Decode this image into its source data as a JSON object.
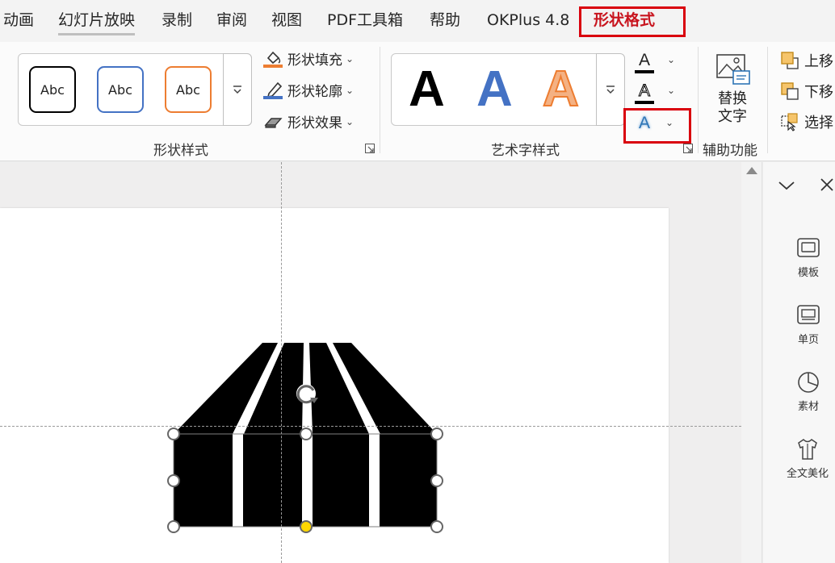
{
  "tabs": [
    {
      "label": "动画"
    },
    {
      "label": "幻灯片放映"
    },
    {
      "label": "录制"
    },
    {
      "label": "审阅"
    },
    {
      "label": "视图"
    },
    {
      "label": "PDF工具箱"
    },
    {
      "label": "帮助"
    },
    {
      "label": "OKPlus 4.8"
    },
    {
      "label": "形状格式",
      "active": true
    }
  ],
  "shape_styles": {
    "presets": [
      {
        "label": "Abc",
        "border": "#000000"
      },
      {
        "label": "Abc",
        "border": "#4472c4"
      },
      {
        "label": "Abc",
        "border": "#ed7d31"
      }
    ],
    "fill_label": "形状填充",
    "outline_label": "形状轮廓",
    "effects_label": "形状效果",
    "group_label": "形状样式"
  },
  "wordart": {
    "presets": [
      {
        "label": "A",
        "color": "#000000"
      },
      {
        "label": "A",
        "color": "#4472c4"
      },
      {
        "label": "A",
        "color": "#f4b183"
      }
    ],
    "text_fill_glyph": "A",
    "text_outline_glyph": "A",
    "text_effects_glyph": "A",
    "group_label": "艺术字样式"
  },
  "accessibility": {
    "alt_text_line1": "替换",
    "alt_text_line2": "文字",
    "group_label": "辅助功能"
  },
  "arrange": {
    "bring_forward": "上移",
    "send_backward": "下移",
    "selection_pane": "选择"
  },
  "side_panel": {
    "items": [
      {
        "label": "模板"
      },
      {
        "label": "单页"
      },
      {
        "label": "素材"
      },
      {
        "label": "全文美化"
      }
    ]
  },
  "colors": {
    "accent_red": "#d9000d",
    "active_tab_text": "#c8141e",
    "adjust_handle": "#ffd700"
  }
}
